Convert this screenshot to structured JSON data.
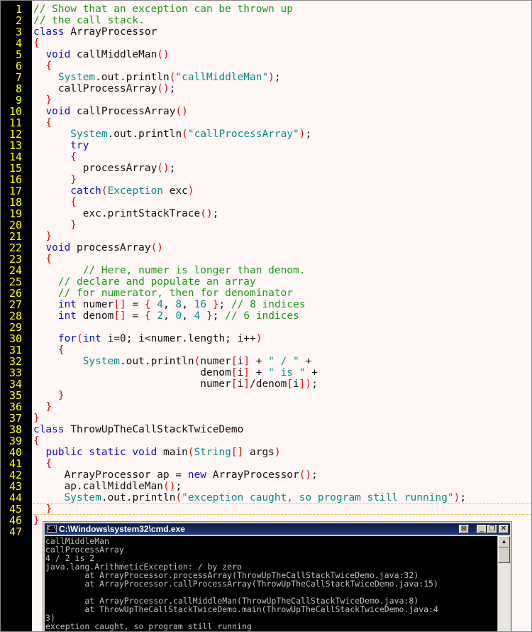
{
  "editor": {
    "line_numbers": [
      "1",
      "2",
      "3",
      "4",
      "5",
      "6",
      "7",
      "8",
      "9",
      "10",
      "11",
      "12",
      "13",
      "14",
      "15",
      "16",
      "17",
      "18",
      "19",
      "20",
      "21",
      "22",
      "23",
      "24",
      "25",
      "26",
      "27",
      "28",
      "29",
      "30",
      "31",
      "32",
      "33",
      "34",
      "35",
      "36",
      "37",
      "38",
      "39",
      "40",
      "41",
      "42",
      "43",
      "44",
      "45",
      "46",
      "47"
    ],
    "current_line": 45,
    "lines": [
      [
        [
          "cm",
          "// Show that an exception can be thrown up"
        ]
      ],
      [
        [
          "cm",
          "// the call stack."
        ]
      ],
      [
        [
          "kw",
          "class"
        ],
        [
          "op",
          " ArrayProcessor"
        ]
      ],
      [
        [
          "br",
          "{"
        ]
      ],
      [
        [
          "op",
          "  "
        ],
        [
          "kw",
          "void"
        ],
        [
          "op",
          " callMiddleMan"
        ],
        [
          "br",
          "()"
        ]
      ],
      [
        [
          "op",
          "  "
        ],
        [
          "br",
          "{"
        ]
      ],
      [
        [
          "op",
          "    "
        ],
        [
          "cl",
          "System"
        ],
        [
          "op",
          ".out.println"
        ],
        [
          "br",
          "("
        ],
        [
          "st",
          "\"callMiddleMan\""
        ],
        [
          "br",
          ")"
        ],
        [
          "op",
          ";"
        ]
      ],
      [
        [
          "op",
          "    callProcessArray"
        ],
        [
          "br",
          "()"
        ],
        [
          "op",
          ";"
        ]
      ],
      [
        [
          "op",
          "  "
        ],
        [
          "br",
          "}"
        ]
      ],
      [
        [
          "op",
          "  "
        ],
        [
          "kw",
          "void"
        ],
        [
          "op",
          " callProcessArray"
        ],
        [
          "br",
          "()"
        ]
      ],
      [
        [
          "op",
          "  "
        ],
        [
          "br",
          "{"
        ]
      ],
      [
        [
          "op",
          "      "
        ],
        [
          "cl",
          "System"
        ],
        [
          "op",
          ".out.println"
        ],
        [
          "br",
          "("
        ],
        [
          "st",
          "\"callProcessArray\""
        ],
        [
          "br",
          ")"
        ],
        [
          "op",
          ";"
        ]
      ],
      [
        [
          "op",
          "      "
        ],
        [
          "kw",
          "try"
        ]
      ],
      [
        [
          "op",
          "      "
        ],
        [
          "br",
          "{"
        ]
      ],
      [
        [
          "op",
          "        processArray"
        ],
        [
          "br",
          "()"
        ],
        [
          "op",
          ";"
        ]
      ],
      [
        [
          "op",
          "      "
        ],
        [
          "br",
          "}"
        ]
      ],
      [
        [
          "op",
          "      "
        ],
        [
          "kw",
          "catch"
        ],
        [
          "br",
          "("
        ],
        [
          "cl",
          "Exception"
        ],
        [
          "op",
          " exc"
        ],
        [
          "br",
          ")"
        ]
      ],
      [
        [
          "op",
          "      "
        ],
        [
          "br",
          "{"
        ]
      ],
      [
        [
          "op",
          "        exc.printStackTrace"
        ],
        [
          "br",
          "()"
        ],
        [
          "op",
          ";"
        ]
      ],
      [
        [
          "op",
          "      "
        ],
        [
          "br",
          "}"
        ]
      ],
      [
        [
          "op",
          "  "
        ],
        [
          "br",
          "}"
        ]
      ],
      [
        [
          "op",
          "  "
        ],
        [
          "kw",
          "void"
        ],
        [
          "op",
          " processArray"
        ],
        [
          "br",
          "()"
        ]
      ],
      [
        [
          "op",
          "  "
        ],
        [
          "br",
          "{"
        ]
      ],
      [
        [
          "op",
          "        "
        ],
        [
          "cm",
          "// Here, numer is longer than denom."
        ]
      ],
      [
        [
          "op",
          "    "
        ],
        [
          "cm",
          "// declare and populate an array"
        ]
      ],
      [
        [
          "op",
          "    "
        ],
        [
          "cm",
          "// for numerator, then for denominator"
        ]
      ],
      [
        [
          "op",
          "    "
        ],
        [
          "kw",
          "int"
        ],
        [
          "op",
          " numer"
        ],
        [
          "br",
          "[]"
        ],
        [
          "op",
          " = "
        ],
        [
          "br",
          "{"
        ],
        [
          "op",
          " "
        ],
        [
          "nm",
          "4"
        ],
        [
          "op",
          ", "
        ],
        [
          "nm",
          "8"
        ],
        [
          "op",
          ", "
        ],
        [
          "nm",
          "16"
        ],
        [
          "op",
          " "
        ],
        [
          "br",
          "}"
        ],
        [
          "op",
          "; "
        ],
        [
          "cm",
          "// 8 indices"
        ]
      ],
      [
        [
          "op",
          "    "
        ],
        [
          "kw",
          "int"
        ],
        [
          "op",
          " denom"
        ],
        [
          "br",
          "[]"
        ],
        [
          "op",
          " = "
        ],
        [
          "br",
          "{"
        ],
        [
          "op",
          " "
        ],
        [
          "nm",
          "2"
        ],
        [
          "op",
          ", "
        ],
        [
          "nm",
          "0"
        ],
        [
          "op",
          ", "
        ],
        [
          "nm",
          "4"
        ],
        [
          "op",
          " "
        ],
        [
          "br",
          "}"
        ],
        [
          "op",
          "; "
        ],
        [
          "cm",
          "// 6 indices"
        ]
      ],
      [
        [
          "op",
          ""
        ]
      ],
      [
        [
          "op",
          "    "
        ],
        [
          "kw",
          "for"
        ],
        [
          "br",
          "("
        ],
        [
          "kw",
          "int"
        ],
        [
          "op",
          " i=0; i<numer.length; i++"
        ],
        [
          "br",
          ")"
        ]
      ],
      [
        [
          "op",
          "    "
        ],
        [
          "br",
          "{"
        ]
      ],
      [
        [
          "op",
          "        "
        ],
        [
          "cl",
          "System"
        ],
        [
          "op",
          ".out.println"
        ],
        [
          "br",
          "("
        ],
        [
          "op",
          "numer"
        ],
        [
          "br",
          "["
        ],
        [
          "op",
          "i"
        ],
        [
          "br",
          "]"
        ],
        [
          "op",
          " + "
        ],
        [
          "st",
          "\" / \""
        ],
        [
          "op",
          " +"
        ]
      ],
      [
        [
          "op",
          "                           denom"
        ],
        [
          "br",
          "["
        ],
        [
          "op",
          "i"
        ],
        [
          "br",
          "]"
        ],
        [
          "op",
          " + "
        ],
        [
          "st",
          "\" is \""
        ],
        [
          "op",
          " +"
        ]
      ],
      [
        [
          "op",
          "                           numer"
        ],
        [
          "br",
          "["
        ],
        [
          "op",
          "i"
        ],
        [
          "br",
          "]"
        ],
        [
          "op",
          "/denom"
        ],
        [
          "br",
          "["
        ],
        [
          "op",
          "i"
        ],
        [
          "br",
          "])"
        ],
        [
          "op",
          ";"
        ]
      ],
      [
        [
          "op",
          "    "
        ],
        [
          "br",
          "}"
        ]
      ],
      [
        [
          "op",
          "  "
        ],
        [
          "br",
          "}"
        ]
      ],
      [
        [
          "br",
          "}"
        ]
      ],
      [
        [
          "kw",
          "class"
        ],
        [
          "op",
          " ThrowUpTheCallStackTwiceDemo"
        ]
      ],
      [
        [
          "br",
          "{"
        ]
      ],
      [
        [
          "op",
          "  "
        ],
        [
          "kw",
          "public static void"
        ],
        [
          "op",
          " main"
        ],
        [
          "br",
          "("
        ],
        [
          "cl",
          "String"
        ],
        [
          "br",
          "[]"
        ],
        [
          "op",
          " args"
        ],
        [
          "br",
          ")"
        ]
      ],
      [
        [
          "op",
          "  "
        ],
        [
          "br",
          "{"
        ]
      ],
      [
        [
          "op",
          "     ArrayProcessor ap = "
        ],
        [
          "kw",
          "new"
        ],
        [
          "op",
          " ArrayProcessor"
        ],
        [
          "br",
          "()"
        ],
        [
          "op",
          ";"
        ]
      ],
      [
        [
          "op",
          "     ap.callMiddleMan"
        ],
        [
          "br",
          "()"
        ],
        [
          "op",
          ";"
        ]
      ],
      [
        [
          "op",
          "     "
        ],
        [
          "cl",
          "System"
        ],
        [
          "op",
          ".out.println"
        ],
        [
          "br",
          "("
        ],
        [
          "st",
          "\"exception caught, so program still running\""
        ],
        [
          "br",
          ")"
        ],
        [
          "op",
          ";"
        ]
      ],
      [
        [
          "op",
          "  "
        ],
        [
          "br",
          "}"
        ]
      ],
      [
        [
          "br",
          "}"
        ]
      ],
      [
        [
          "op",
          ""
        ]
      ]
    ]
  },
  "cmd": {
    "title": "C:\\Windows\\system32\\cmd.exe",
    "icon_text": "C:\\",
    "minimize": "_",
    "restore": "❐",
    "close": "✕",
    "extra": "⊠",
    "output": [
      "callMiddleMan",
      "callProcessArray",
      "4 / 2 is 2",
      "java.lang.ArithmeticException: / by zero",
      "        at ArrayProcessor.processArray(ThrowUpTheCallStackTwiceDemo.java:32)",
      "        at ArrayProcessor.callProcessArray(ThrowUpTheCallStackTwiceDemo.java:15)",
      "",
      "        at ArrayProcessor.callMiddleMan(ThrowUpTheCallStackTwiceDemo.java:8)",
      "        at ThrowUpTheCallStackTwiceDemo.main(ThrowUpTheCallStackTwiceDemo.java:4",
      "3)",
      "exception caught, so program still running"
    ]
  }
}
